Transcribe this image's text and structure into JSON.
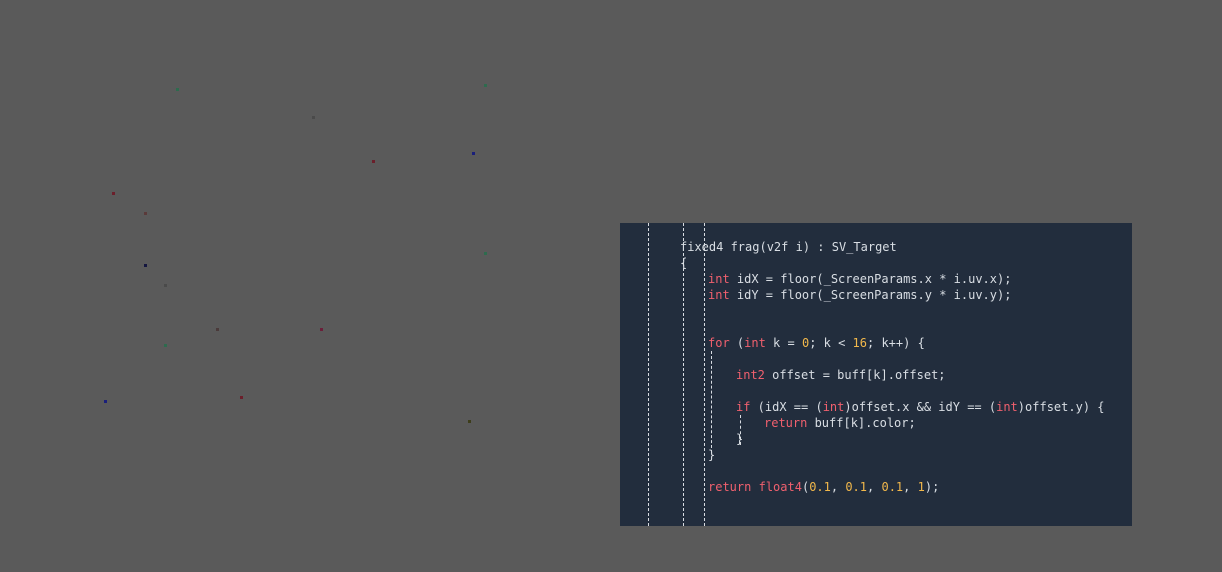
{
  "colors": {
    "background": "#5a5a5a",
    "code_background": "#222d3d",
    "code_text": "#d9dee4",
    "keyword": "#f0606e",
    "number": "#f2b84b",
    "guide": "#d8dce2"
  },
  "code": {
    "l1": "fixed4 frag(v2f i) : SV_Target",
    "l2": "{",
    "l3": {
      "kw": "int",
      "rest": " idX = floor(_ScreenParams.x * i.uv.x);"
    },
    "l4": {
      "kw": "int",
      "rest": " idY = floor(_ScreenParams.y * i.uv.y);"
    },
    "l5": {
      "for": "for",
      "open": " (",
      "int": "int",
      "a": " k = ",
      "zero": "0",
      "b": "; k < ",
      "sixteen": "16",
      "c": "; k++) {"
    },
    "l6": {
      "kw": "int2",
      "rest": " offset = buff[k].offset;"
    },
    "l7": {
      "if": "if",
      "a": " (idX == (",
      "int1": "int",
      "b": ")offset.x && idY == (",
      "int2": "int",
      "c": ")offset.y) {"
    },
    "l8": {
      "kw": "return",
      "rest": " buff[k].color;"
    },
    "l9": "}",
    "l10": "}",
    "l11": {
      "ret": "return",
      "sp": " ",
      "fn": "float4",
      "p": "(",
      "n1": "0.1",
      "c1": ", ",
      "n2": "0.1",
      "c2": ", ",
      "n3": "0.1",
      "c3": ", ",
      "n4": "1",
      "end": ");"
    }
  },
  "pixels": [
    {
      "color": "#2e6b4e"
    },
    {
      "color": "#2e6b4e"
    },
    {
      "color": "#4a4a4a"
    },
    {
      "color": "#6b1f2b"
    },
    {
      "color": "#1a1f7a"
    },
    {
      "color": "#6b1f2b"
    },
    {
      "color": "#5a3a3a"
    },
    {
      "color": "#2e6b4e"
    },
    {
      "color": "#14163f"
    },
    {
      "color": "#4a4a4a"
    },
    {
      "color": "#4a3a3a"
    },
    {
      "color": "#6b1f3a"
    },
    {
      "color": "#2e6b4e"
    },
    {
      "color": "#1a1f7a"
    },
    {
      "color": "#6b1f2b"
    },
    {
      "color": "#3d3d1a"
    }
  ]
}
